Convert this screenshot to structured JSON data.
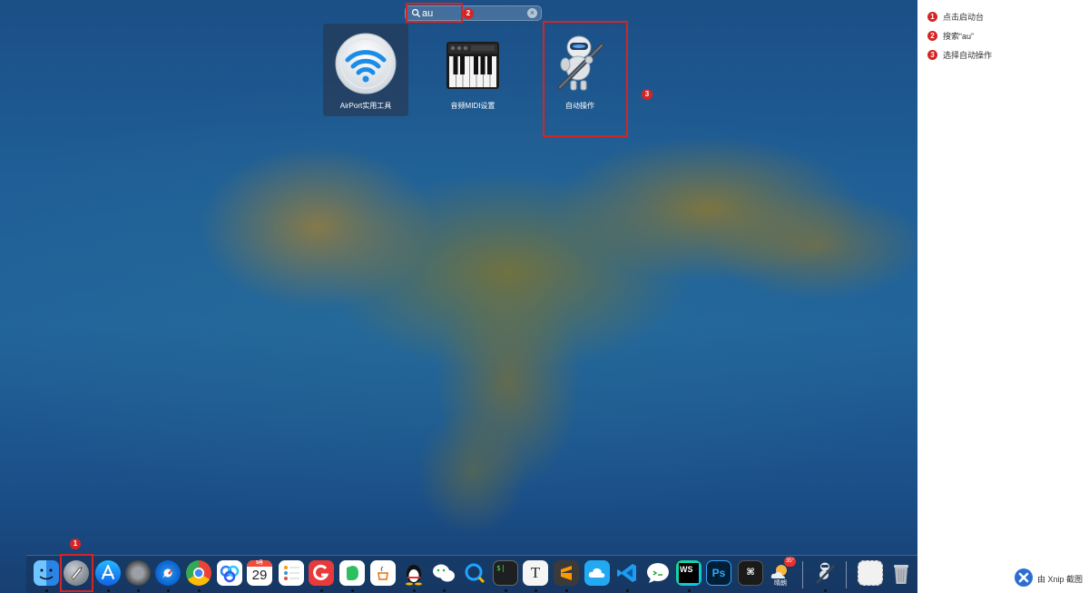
{
  "search": {
    "query": "au"
  },
  "apps": [
    {
      "label": "AirPort实用工具"
    },
    {
      "label": "音频MIDI设置"
    },
    {
      "label": "自动操作"
    }
  ],
  "annotations": {
    "badge_1": "1",
    "badge_2": "2",
    "badge_3": "3"
  },
  "dock": {
    "calendar_month": "9月",
    "calendar_day": "29",
    "weather_temp": "35°",
    "weather_label": "晴朗"
  },
  "steps": [
    {
      "num": "1",
      "text": "点击启动台"
    },
    {
      "num": "2",
      "text": "搜索“au”"
    },
    {
      "num": "3",
      "text": "选择自动操作"
    }
  ],
  "footer": {
    "text": "由 Xnip 截图"
  },
  "colors": {
    "highlight": "#d42525",
    "wallpaper_sea": "#1f5e96"
  }
}
